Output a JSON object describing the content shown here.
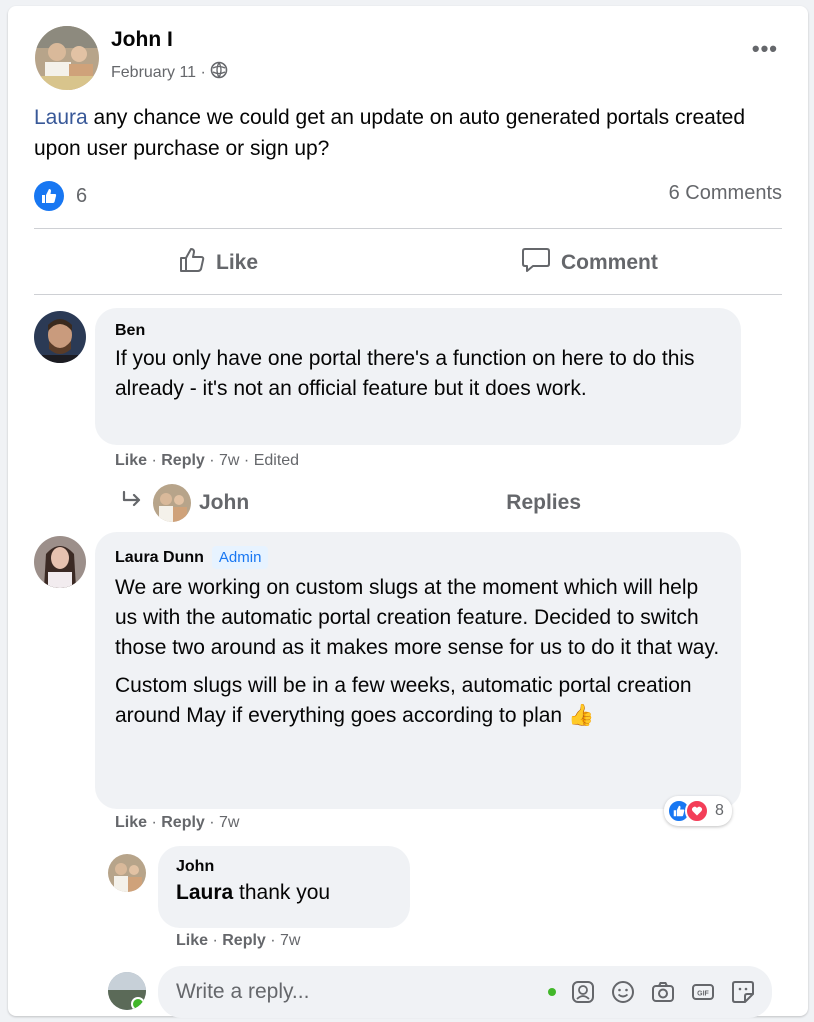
{
  "post": {
    "author": "John I",
    "date": "February 11 ·",
    "more": "•••",
    "mention": "Laura",
    "text": " any chance we could get an update on auto generated portals created upon user purchase or sign up?",
    "like_count": "6",
    "comments_count": "6 Comments",
    "like_label": "Like",
    "comment_label": "Comment"
  },
  "comments": [
    {
      "author": "Ben",
      "text": "If you only have one portal there's a function on here to do this already - it's not an official feature but it does work.",
      "like": "Like",
      "sep1": " · ",
      "reply": "Reply",
      "meta": " · 7w · Edited",
      "replies_author": "John",
      "replies_label": "Replies"
    },
    {
      "author": "Laura Dunn",
      "badge": "Admin",
      "paragraph1": "We are working on custom slugs at the moment which will help us with the automatic portal creation feature. Decided to switch those two around as it makes more sense for us to do it that way.",
      "paragraph2": "Custom slugs will be in a few weeks, automatic portal creation around May if everything goes according to plan",
      "emoji": "👍",
      "reaction_count": "8",
      "like": "Like",
      "sep1": " · ",
      "reply": "Reply",
      "meta": " · 7w"
    },
    {
      "author": "John",
      "mention": "Laura",
      "text": " thank you",
      "like": "Like",
      "sep1": " · ",
      "reply": "Reply",
      "meta": " · 7w"
    }
  ],
  "reply_box": {
    "placeholder": "Write a reply..."
  },
  "colors": {
    "accent": "#1877f2",
    "mention": "#385898",
    "love": "#f33e58",
    "bubble": "#f0f2f5"
  }
}
